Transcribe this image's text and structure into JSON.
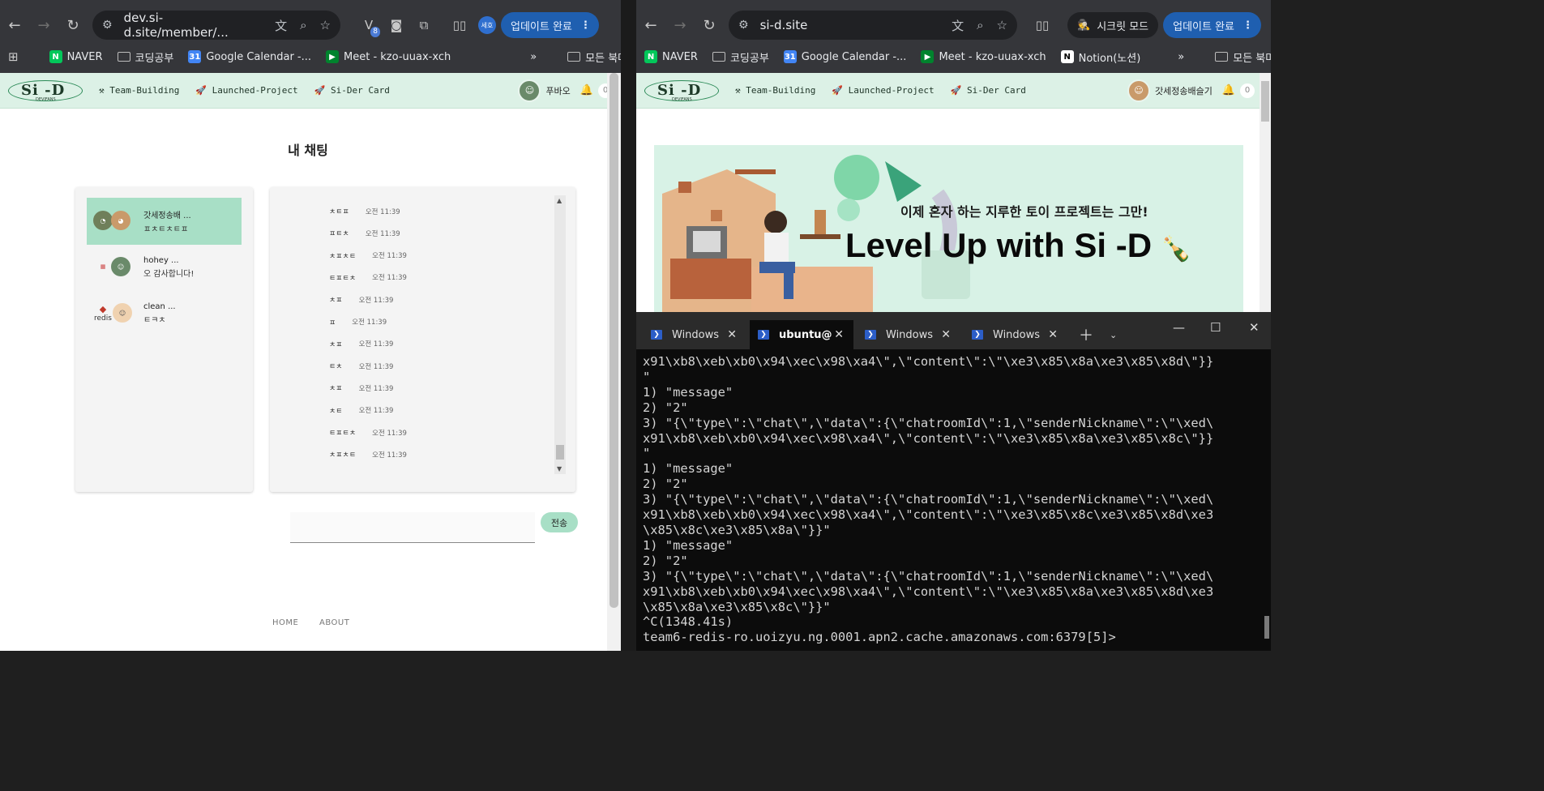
{
  "left_window": {
    "address": "dev.si-d.site/member/...",
    "extension_badge": "8",
    "profile_chip": "세호",
    "update_label": "업데이트 완료",
    "bookmarks": [
      {
        "label": "NAVER",
        "icon": "naver-icon",
        "color": "#03c75a"
      },
      {
        "label": "코딩공부",
        "icon": "folder-icon"
      },
      {
        "label": "Google Calendar -...",
        "icon": "calendar-icon",
        "color": "#4285f4"
      },
      {
        "label": "Meet - kzo-uuax-xch",
        "icon": "meet-icon",
        "color": "#00832d"
      }
    ],
    "all_bookmarks": "모든 북마크",
    "site": {
      "nav": [
        "Team-Building",
        "Launched-Project",
        "Si-Der Card"
      ],
      "user_nickname": "푸바오",
      "notification_count": "0",
      "page_title": "내 채팅",
      "rooms": [
        {
          "name": "갓세정송배 ...",
          "last_message": "ㅍㅊㅌㅊㅌㅍ",
          "active": true
        },
        {
          "name": "hohey ...",
          "last_message": "오 감사합니다!",
          "active": false
        },
        {
          "name": "clean ...",
          "last_message": "ㅌㅋㅊ",
          "active": false,
          "avatar_caption": "redis"
        }
      ],
      "messages": [
        {
          "text": "ㅊㅌㅍ",
          "time": "오전 11:39"
        },
        {
          "text": "ㅍㅌㅊ",
          "time": "오전 11:39"
        },
        {
          "text": "ㅊㅍㅊㅌ",
          "time": "오전 11:39"
        },
        {
          "text": "ㅌㅍㅌㅊ",
          "time": "오전 11:39"
        },
        {
          "text": "ㅊㅍ",
          "time": "오전 11:39"
        },
        {
          "text": "ㅍ",
          "time": "오전 11:39"
        },
        {
          "text": "ㅊㅍ",
          "time": "오전 11:39"
        },
        {
          "text": "ㅌㅊ",
          "time": "오전 11:39"
        },
        {
          "text": "ㅊㅍ",
          "time": "오전 11:39"
        },
        {
          "text": "ㅊㅌ",
          "time": "오전 11:39"
        },
        {
          "text": "ㅌㅍㅌㅊ",
          "time": "오전 11:39"
        },
        {
          "text": "ㅊㅍㅊㅌ",
          "time": "오전 11:39"
        }
      ],
      "send_label": "전송",
      "footer": [
        "HOME",
        "ABOUT"
      ]
    }
  },
  "right_window": {
    "address": "si-d.site",
    "incognito_label": "시크릿 모드",
    "update_label": "업데이트 완료",
    "bookmarks": [
      {
        "label": "NAVER",
        "icon": "naver-icon",
        "color": "#03c75a"
      },
      {
        "label": "코딩공부",
        "icon": "folder-icon"
      },
      {
        "label": "Google Calendar -...",
        "icon": "calendar-icon",
        "color": "#4285f4"
      },
      {
        "label": "Meet - kzo-uuax-xch",
        "icon": "meet-icon",
        "color": "#00832d"
      },
      {
        "label": "Notion(노션)",
        "icon": "notion-icon",
        "color": "#ffffff"
      }
    ],
    "all_bookmarks": "모든 북마크",
    "site": {
      "nav": [
        "Team-Building",
        "Launched-Project",
        "Si-Der Card"
      ],
      "user_nickname": "갓세정송배슬기",
      "notification_count": "0",
      "banner_subtitle": "이제 혼자 하는 지루한 토이 프로젝트는 그만!",
      "banner_title": "Level Up with Si -D"
    }
  },
  "terminal": {
    "tabs": [
      {
        "label": "Windows",
        "active": false
      },
      {
        "label": "ubuntu@",
        "active": true
      },
      {
        "label": "Windows",
        "active": false
      },
      {
        "label": "Windows",
        "active": false
      }
    ],
    "lines": [
      "x91\\xb8\\xeb\\xb0\\x94\\xec\\x98\\xa4\\\",\\\"content\\\":\\\"\\xe3\\x85\\x8a\\xe3\\x85\\x8d\\\"}}",
      "\"",
      "1) \"message\"",
      "2) \"2\"",
      "3) \"{\\\"type\\\":\\\"chat\\\",\\\"data\\\":{\\\"chatroomId\\\":1,\\\"senderNickname\\\":\\\"\\xed\\",
      "x91\\xb8\\xeb\\xb0\\x94\\xec\\x98\\xa4\\\",\\\"content\\\":\\\"\\xe3\\x85\\x8a\\xe3\\x85\\x8c\\\"}}",
      "\"",
      "1) \"message\"",
      "2) \"2\"",
      "3) \"{\\\"type\\\":\\\"chat\\\",\\\"data\\\":{\\\"chatroomId\\\":1,\\\"senderNickname\\\":\\\"\\xed\\",
      "x91\\xb8\\xeb\\xb0\\x94\\xec\\x98\\xa4\\\",\\\"content\\\":\\\"\\xe3\\x85\\x8c\\xe3\\x85\\x8d\\xe3",
      "\\x85\\x8c\\xe3\\x85\\x8a\\\"}}\"",
      "1) \"message\"",
      "2) \"2\"",
      "3) \"{\\\"type\\\":\\\"chat\\\",\\\"data\\\":{\\\"chatroomId\\\":1,\\\"senderNickname\\\":\\\"\\xed\\",
      "x91\\xb8\\xeb\\xb0\\x94\\xec\\x98\\xa4\\\",\\\"content\\\":\\\"\\xe3\\x85\\x8a\\xe3\\x85\\x8d\\xe3",
      "\\x85\\x8a\\xe3\\x85\\x8c\\\"}}\"",
      "^C(1348.41s)",
      "team6-redis-ro.uoizyu.ng.0001.apn2.cache.amazonaws.com:6379[5]>"
    ]
  }
}
